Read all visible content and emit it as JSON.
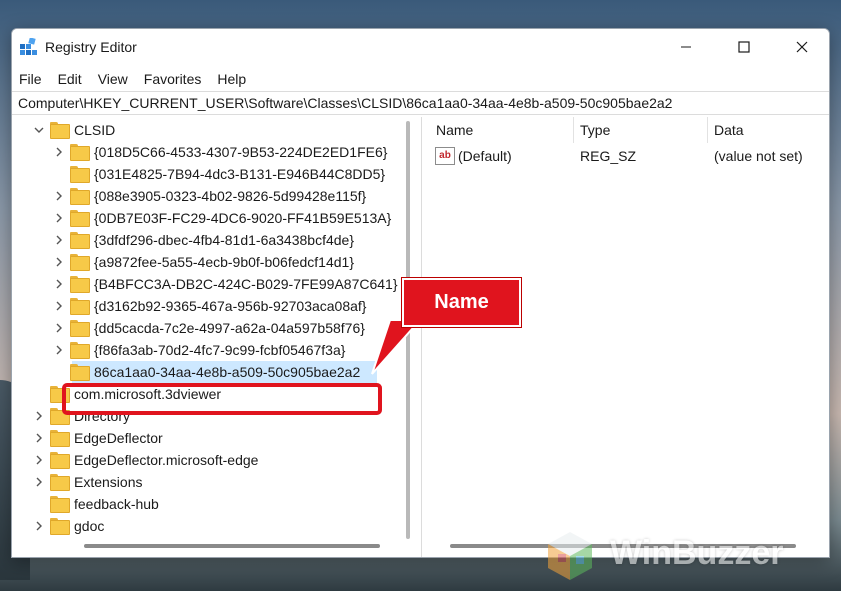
{
  "window": {
    "title": "Registry Editor"
  },
  "menu": {
    "items": [
      "File",
      "Edit",
      "View",
      "Favorites",
      "Help"
    ]
  },
  "address": {
    "path": "Computer\\HKEY_CURRENT_USER\\Software\\Classes\\CLSID\\86ca1aa0-34aa-4e8b-a509-50c905bae2a2"
  },
  "tree": {
    "items": [
      {
        "label": "CLSID",
        "expanded": true
      },
      {
        "label": "{018D5C66-4533-4307-9B53-224DE2ED1FE6}"
      },
      {
        "label": "{031E4825-7B94-4dc3-B131-E946B44C8DD5}"
      },
      {
        "label": "{088e3905-0323-4b02-9826-5d99428e115f}"
      },
      {
        "label": "{0DB7E03F-FC29-4DC6-9020-FF41B59E513A}"
      },
      {
        "label": "{3dfdf296-dbec-4fb4-81d1-6a3438bcf4de}"
      },
      {
        "label": "{a9872fee-5a55-4ecb-9b0f-b06fedcf14d1}"
      },
      {
        "label": "{B4BFCC3A-DB2C-424C-B029-7FE99A87C641}"
      },
      {
        "label": "{d3162b92-9365-467a-956b-92703aca08af}"
      },
      {
        "label": "{dd5cacda-7c2e-4997-a62a-04a597b58f76}"
      },
      {
        "label": "{f86fa3ab-70d2-4fc7-9c99-fcbf05467f3a}"
      },
      {
        "label": "86ca1aa0-34aa-4e8b-a509-50c905bae2a2",
        "selected": true
      },
      {
        "label": "com.microsoft.3dviewer"
      },
      {
        "label": "Directory"
      },
      {
        "label": "EdgeDeflector"
      },
      {
        "label": "EdgeDeflector.microsoft-edge"
      },
      {
        "label": "Extensions"
      },
      {
        "label": "feedback-hub"
      },
      {
        "label": "gdoc"
      }
    ]
  },
  "list": {
    "headers": {
      "name": "Name",
      "type": "Type",
      "data": "Data"
    },
    "rows": [
      {
        "name": "(Default)",
        "type": "REG_SZ",
        "data": "(value not set)",
        "icon": "string-value-icon"
      }
    ]
  },
  "annotation": {
    "callout_label": "Name",
    "color": "#e0141e"
  },
  "watermark": {
    "text": "WinBuzzer"
  },
  "colors": {
    "selection": "#cde8ff",
    "folder": "#f7c948"
  }
}
